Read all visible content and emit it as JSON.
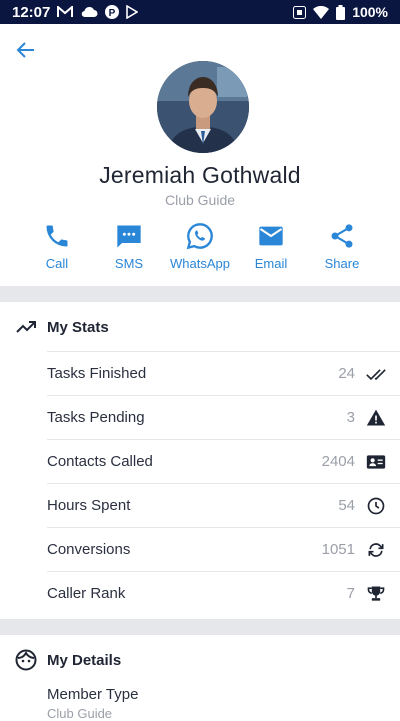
{
  "status_bar": {
    "time": "12:07",
    "battery": "100%",
    "left_icons": [
      "gmail-icon",
      "cloud-icon",
      "p-icon",
      "play-store-icon"
    ],
    "right_icons": [
      "nfc-icon",
      "wifi-icon",
      "battery-icon"
    ]
  },
  "profile": {
    "name": "Jeremiah Gothwald",
    "role": "Club Guide"
  },
  "actions": [
    {
      "label": "Call",
      "icon": "phone-icon"
    },
    {
      "label": "SMS",
      "icon": "sms-icon"
    },
    {
      "label": "WhatsApp",
      "icon": "whatsapp-icon"
    },
    {
      "label": "Email",
      "icon": "email-icon"
    },
    {
      "label": "Share",
      "icon": "share-icon"
    }
  ],
  "stats": {
    "title": "My Stats",
    "icon": "trending-up-icon",
    "rows": [
      {
        "label": "Tasks Finished",
        "value": "24",
        "icon": "double-check-icon"
      },
      {
        "label": "Tasks Pending",
        "value": "3",
        "icon": "warning-icon"
      },
      {
        "label": "Contacts Called",
        "value": "2404",
        "icon": "contact-card-icon"
      },
      {
        "label": "Hours Spent",
        "value": "54",
        "icon": "clock-icon"
      },
      {
        "label": "Conversions",
        "value": "1051",
        "icon": "sync-icon"
      },
      {
        "label": "Caller Rank",
        "value": "7",
        "icon": "trophy-icon"
      }
    ]
  },
  "details": {
    "title": "My Details",
    "icon": "face-icon",
    "member_type_label": "Member Type",
    "member_type_value": "Club Guide"
  },
  "colors": {
    "accent": "#2a86d6",
    "status_bar": "#0b1640",
    "band": "#e6e7ea"
  }
}
